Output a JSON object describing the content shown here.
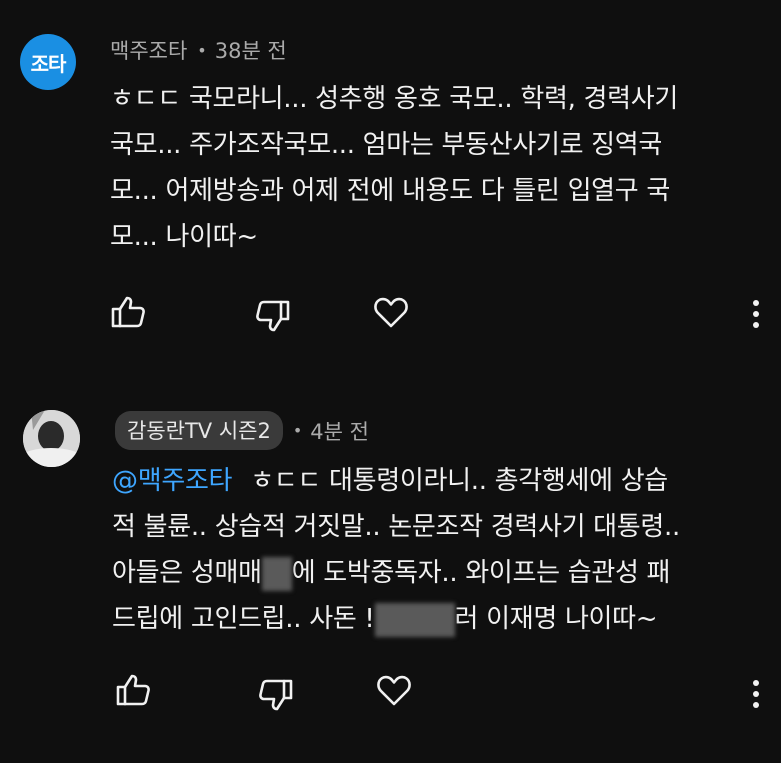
{
  "comments": [
    {
      "avatar_text": "조타",
      "author": "맥주조타",
      "separator": "•",
      "time": "38분 전",
      "lines": [
        "ㅎㄷㄷ 국모라니... 성추행 옹호 국모.. 학력, 경력사기",
        "국모... 주가조작국모... 엄마는 부동산사기로 징역국",
        "모... 어제방송과 어제 전에 내용도 다 틀린 입열구 국",
        "모... 나이따~"
      ]
    },
    {
      "author": "감동란TV 시즌2",
      "separator": "•",
      "time": "4분 전",
      "mention": "@맥주조타",
      "line1_text": "ㅎㄷㄷ 대통령이라니.. 총각행세에 상습",
      "line2": "적 불륜.. 상습적 거짓말.. 논문조작 경력사기 대통령..",
      "line3_a": "아들은 성매매",
      "line3_b": "에 도박중독자.. 와이프는 습관성 패",
      "line4_a": "드립에 고인드립.. 사돈 !",
      "line4_b": "러 이재명 나이따~"
    }
  ],
  "colors": {
    "background": "#0f0f0f",
    "text": "#f1f1f1",
    "meta": "#aaaaaa",
    "mention": "#3ea6ff",
    "avatar": "#1a8fe3"
  },
  "icons": [
    "thumbs-up-icon",
    "thumbs-down-icon",
    "heart-icon",
    "more-vert-icon"
  ]
}
